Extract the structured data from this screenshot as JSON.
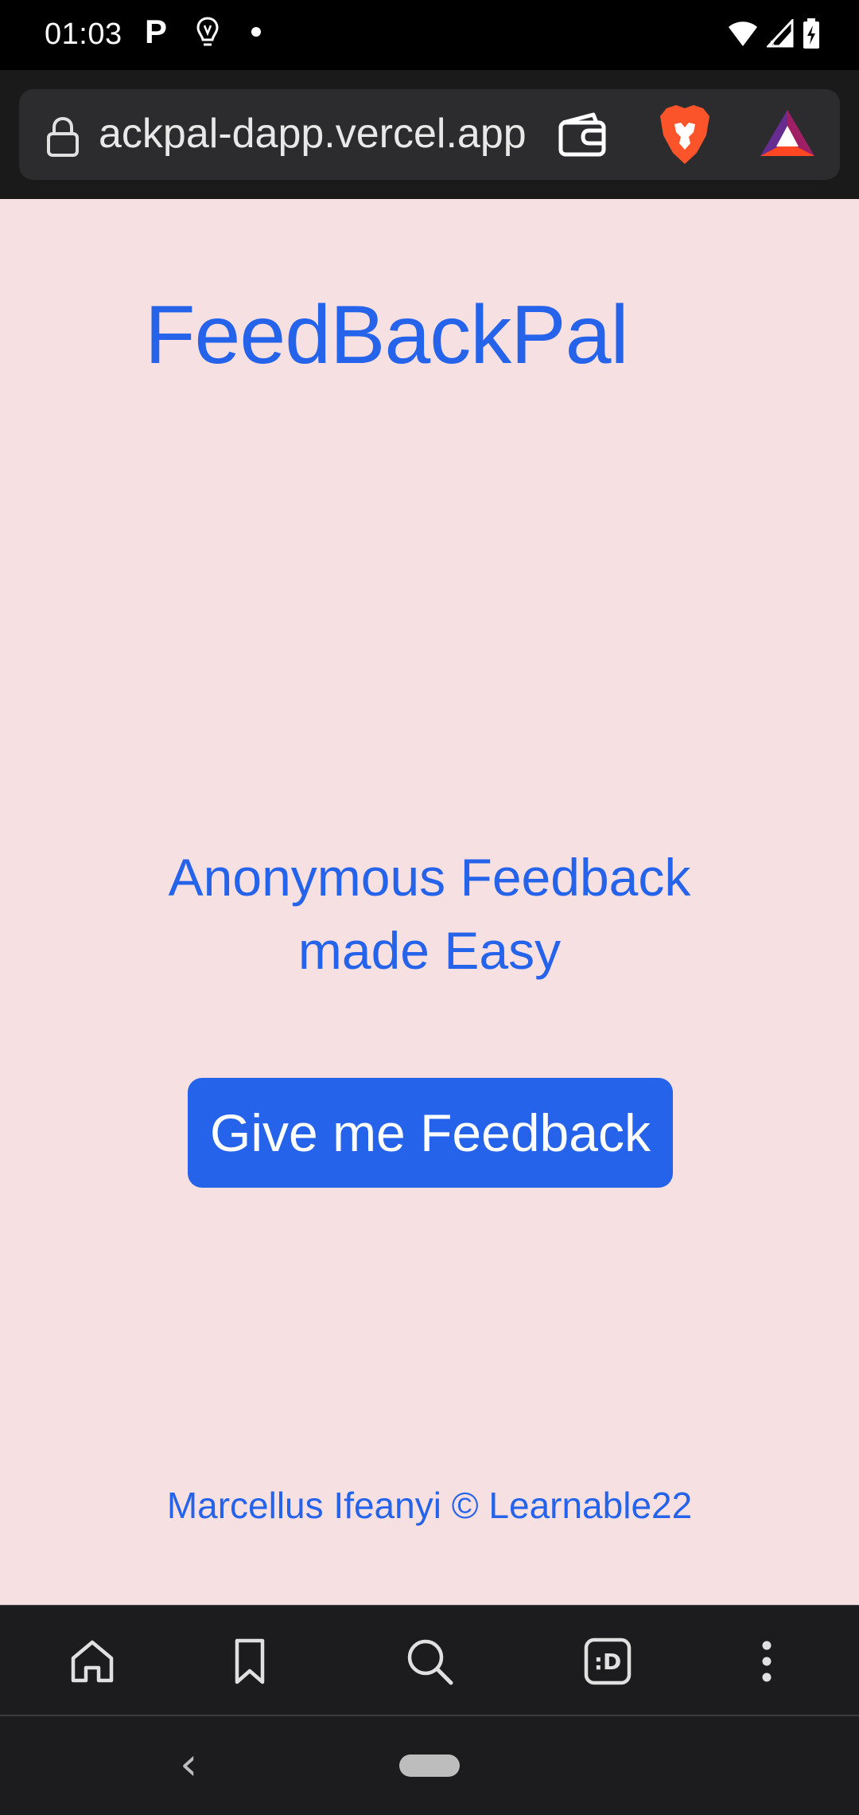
{
  "status_bar": {
    "time": "01:03",
    "left_icons": [
      "parking-app-icon",
      "bulb-icon",
      "notification-dot-icon"
    ],
    "right_icons": [
      "wifi-icon",
      "cell-signal-icon",
      "battery-charging-icon"
    ]
  },
  "browser": {
    "url": "ackpal-dapp.vercel.app",
    "icons": [
      "lock-icon",
      "wallet-icon",
      "brave-lion-icon",
      "bat-rewards-icon"
    ]
  },
  "page": {
    "title": "FeedBackPal",
    "tagline_line1": "Anonymous Feedback",
    "tagline_line2": "made Easy",
    "cta_label": "Give me Feedback",
    "footer": "Marcellus Ifeanyi © Learnable22"
  },
  "toolbar": {
    "items": [
      "home-icon",
      "bookmark-icon",
      "search-icon",
      "tabs-icon",
      "more-vertical-icon"
    ],
    "tabs_label": ":D"
  },
  "colors": {
    "accent": "#2563eb",
    "page_background": "#f7e0e2",
    "chrome_dark": "#1c1c1e",
    "brave_orange": "#fb542b"
  }
}
